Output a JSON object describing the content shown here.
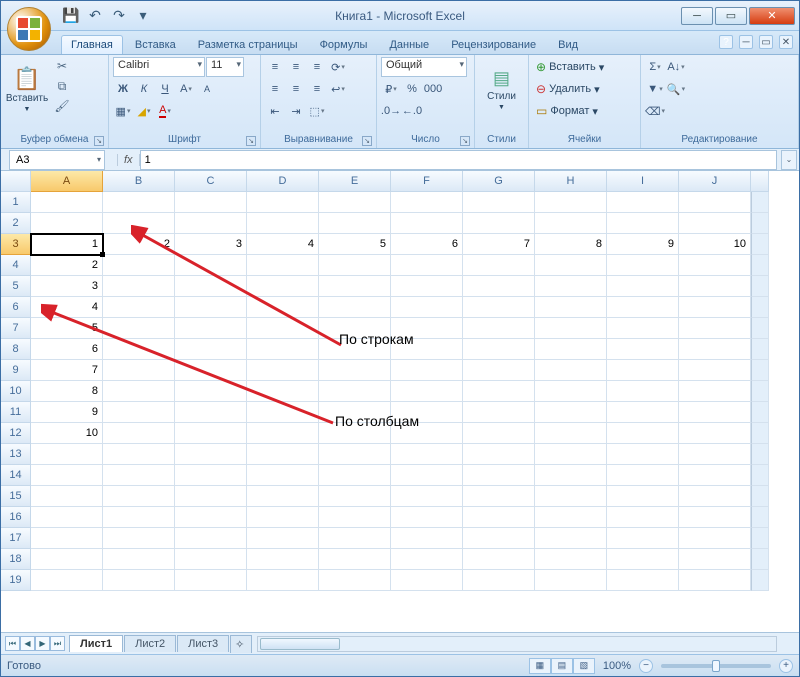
{
  "window": {
    "title": "Книга1 - Microsoft Excel"
  },
  "qat": {
    "save": "💾",
    "undo": "↶",
    "redo": "↷",
    "more": "▾"
  },
  "tabs": {
    "items": [
      "Главная",
      "Вставка",
      "Разметка страницы",
      "Формулы",
      "Данные",
      "Рецензирование",
      "Вид"
    ],
    "active_index": 0
  },
  "ribbon": {
    "clipboard": {
      "label": "Буфер обмена",
      "paste": "Вставить"
    },
    "font": {
      "label": "Шрифт",
      "name": "Calibri",
      "size": "11"
    },
    "alignment": {
      "label": "Выравнивание"
    },
    "number": {
      "label": "Число",
      "format": "Общий"
    },
    "styles": {
      "label": "Стили",
      "btn": "Стили"
    },
    "cells": {
      "label": "Ячейки",
      "insert": "Вставить",
      "delete": "Удалить",
      "format": "Формат"
    },
    "editing": {
      "label": "Редактирование"
    }
  },
  "formula_bar": {
    "name_box": "A3",
    "fx": "fx",
    "value": "1"
  },
  "grid": {
    "columns": [
      "A",
      "B",
      "C",
      "D",
      "E",
      "F",
      "G",
      "H",
      "I",
      "J"
    ],
    "rows": [
      "1",
      "2",
      "3",
      "4",
      "5",
      "6",
      "7",
      "8",
      "9",
      "10",
      "11",
      "12",
      "13",
      "14",
      "15",
      "16",
      "17",
      "18",
      "19"
    ],
    "active_cell": "A3",
    "data": {
      "A3": "1",
      "B3": "2",
      "C3": "3",
      "D3": "4",
      "E3": "5",
      "F3": "6",
      "G3": "7",
      "H3": "8",
      "I3": "9",
      "J3": "10",
      "A4": "2",
      "A5": "3",
      "A6": "4",
      "A7": "5",
      "A8": "6",
      "A9": "7",
      "A10": "8",
      "A11": "9",
      "A12": "10"
    }
  },
  "annotations": {
    "by_rows": "По строкам",
    "by_cols": "По столбцам"
  },
  "sheets": {
    "items": [
      "Лист1",
      "Лист2",
      "Лист3"
    ],
    "active_index": 0
  },
  "status": {
    "ready": "Готово",
    "zoom": "100%"
  }
}
